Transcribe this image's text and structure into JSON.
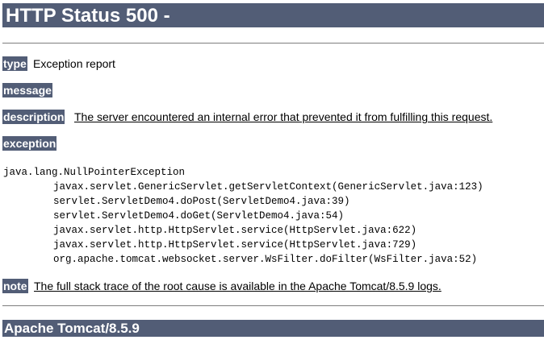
{
  "header": {
    "title": "HTTP Status 500 -"
  },
  "type": {
    "label": "type",
    "value": "Exception report"
  },
  "message": {
    "label": "message",
    "value": ""
  },
  "description": {
    "label": "description",
    "value": "The server encountered an internal error that prevented it from fulfilling this request."
  },
  "exception": {
    "label": "exception",
    "lines": [
      "java.lang.NullPointerException",
      "javax.servlet.GenericServlet.getServletContext(GenericServlet.java:123)",
      "servlet.ServletDemo4.doPost(ServletDemo4.java:39)",
      "servlet.ServletDemo4.doGet(ServletDemo4.java:54)",
      "javax.servlet.http.HttpServlet.service(HttpServlet.java:622)",
      "javax.servlet.http.HttpServlet.service(HttpServlet.java:729)",
      "org.apache.tomcat.websocket.server.WsFilter.doFilter(WsFilter.java:52)"
    ]
  },
  "note": {
    "label": "note",
    "value": "The full stack trace of the root cause is available in the Apache Tomcat/8.5.9 logs."
  },
  "footer": {
    "server": "Apache Tomcat/8.5.9"
  },
  "colors": {
    "header_bg": "#525d76",
    "header_text": "#ffffff",
    "rule": "#7d7d7d"
  }
}
